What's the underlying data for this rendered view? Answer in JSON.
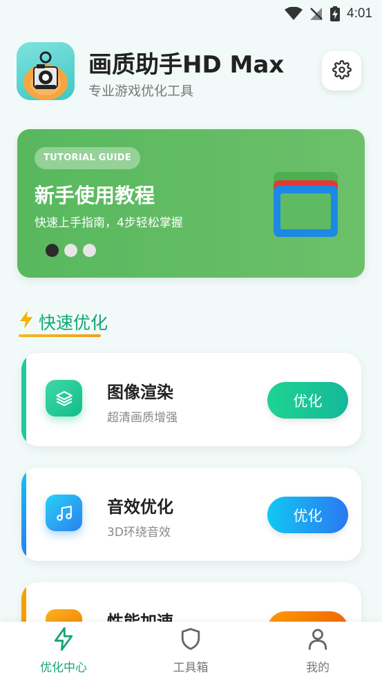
{
  "status_bar": {
    "time": "4:01",
    "icons": [
      "wifi-icon",
      "no-signal-icon",
      "battery-charging-icon"
    ]
  },
  "header": {
    "app_name": "画质助手HD Max",
    "subtitle": "专业游戏优化工具",
    "settings_icon": "gear-icon"
  },
  "banner": {
    "tag": "TUTORIAL GUIDE",
    "title": "新手使用教程",
    "subtitle": "快速上手指南，4步轻松掌握",
    "current_slide": 1,
    "slide_count": 3
  },
  "section": {
    "title": "快速优化",
    "icon": "lightning-icon"
  },
  "cards": [
    {
      "title": "图像渲染",
      "desc": "超清画质增强",
      "button": "优化",
      "icon": "layers-icon",
      "accent": "#1fc998"
    },
    {
      "title": "音效优化",
      "desc": "3D环绕音效",
      "button": "优化",
      "icon": "music-note-icon",
      "accent": "#1aa6f0"
    },
    {
      "title": "性能加速",
      "desc": "",
      "button": "",
      "icon": "rocket-icon",
      "accent": "#f5a000"
    }
  ],
  "bottom_nav": [
    {
      "label": "优化中心",
      "icon": "lightning-icon",
      "active": true
    },
    {
      "label": "工具箱",
      "icon": "shield-icon",
      "active": false
    },
    {
      "label": "我的",
      "icon": "user-icon",
      "active": false
    }
  ],
  "colors": {
    "primary": "#17a673",
    "banner_green": "#5fbb63",
    "background": "#f1faf8"
  }
}
